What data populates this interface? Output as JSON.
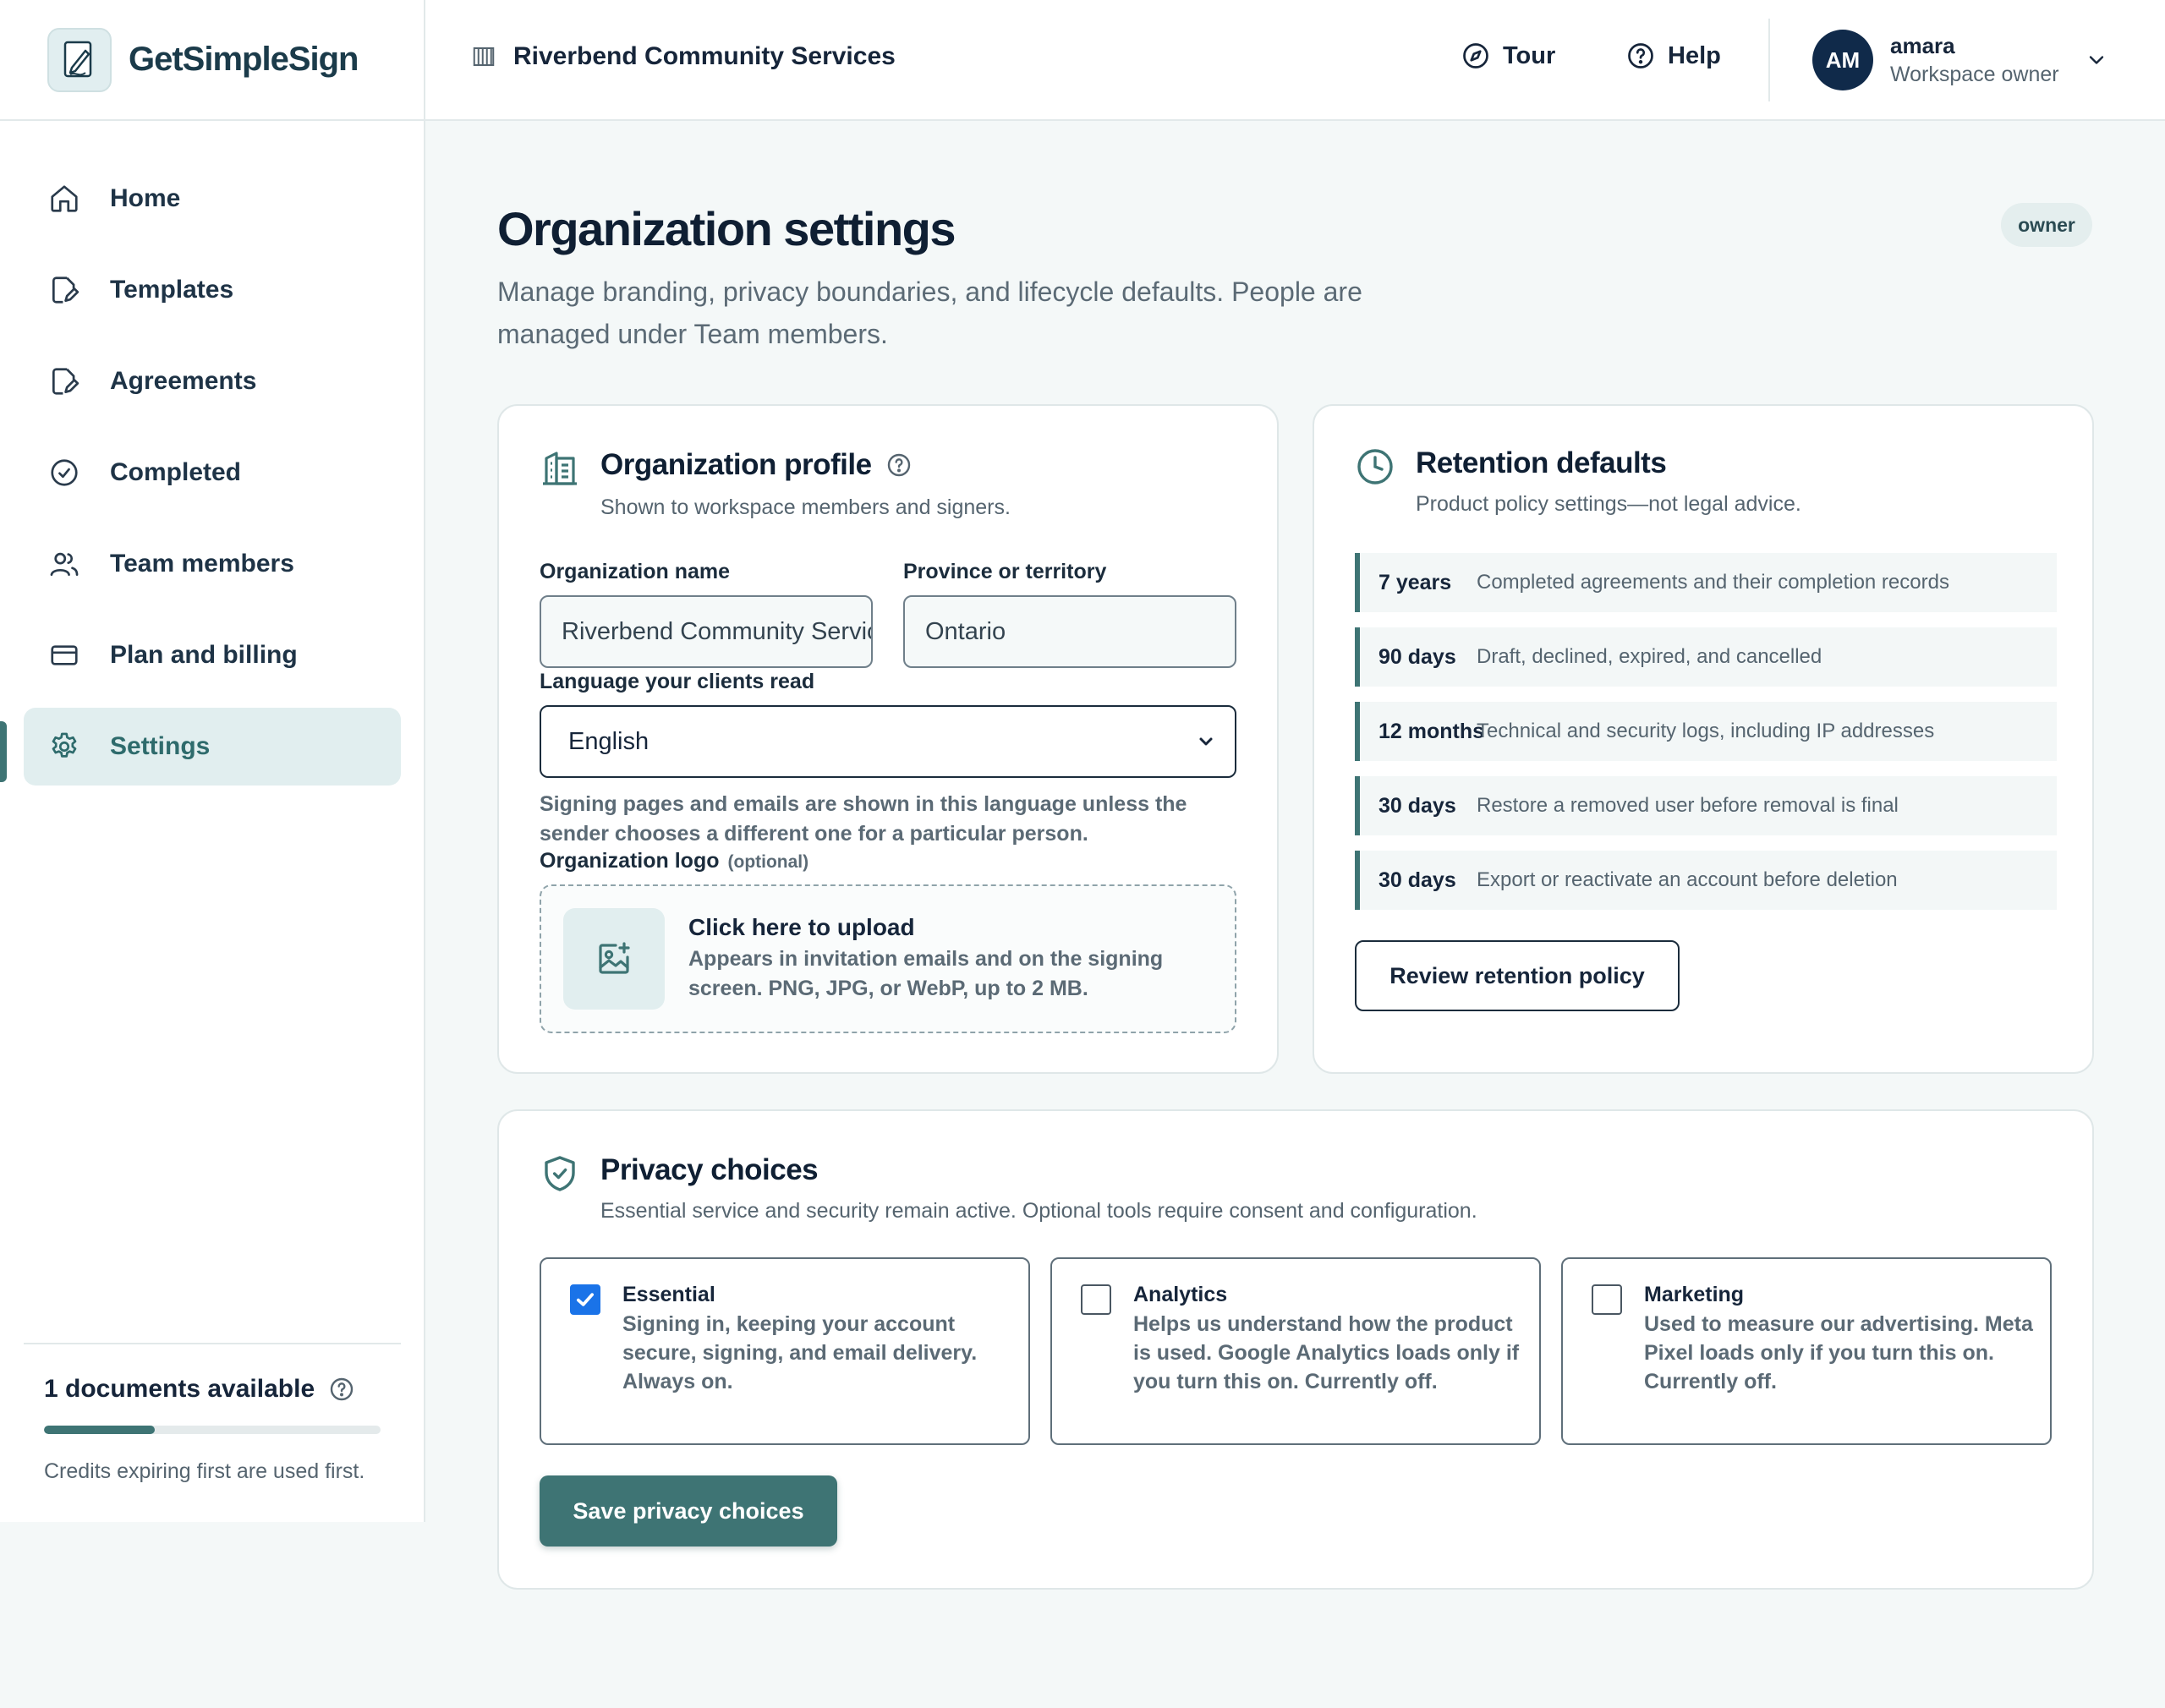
{
  "app": {
    "name": "GetSimpleSign"
  },
  "header": {
    "organization": "Riverbend Community Services",
    "tour_label": "Tour",
    "help_label": "Help",
    "user": {
      "initials": "AM",
      "name": "amara",
      "role": "Workspace owner"
    }
  },
  "sidebar": {
    "items": [
      {
        "label": "Home",
        "icon": "home-icon"
      },
      {
        "label": "Templates",
        "icon": "document-edit-icon"
      },
      {
        "label": "Agreements",
        "icon": "document-edit-icon"
      },
      {
        "label": "Completed",
        "icon": "check-circle-icon"
      },
      {
        "label": "Team members",
        "icon": "users-icon"
      },
      {
        "label": "Plan and billing",
        "icon": "credit-card-icon"
      },
      {
        "label": "Settings",
        "icon": "gear-icon",
        "active": true
      }
    ],
    "credits": {
      "title": "1 documents available",
      "note": "Credits expiring first are used first.",
      "usage_fraction": 0.33
    }
  },
  "page": {
    "title": "Organization settings",
    "role_badge": "owner",
    "subtitle": "Manage branding, privacy boundaries, and lifecycle defaults. People are managed under Team members."
  },
  "profile": {
    "title": "Organization profile",
    "subtitle": "Shown to workspace members and signers.",
    "org_name_label": "Organization name",
    "org_name_value": "Riverbend Community Services",
    "province_label": "Province or territory",
    "province_value": "Ontario",
    "language_label": "Language your clients read",
    "language_value": "English",
    "language_help": "Signing pages and emails are shown in this language unless the sender chooses a different one for a particular person.",
    "logo_label": "Organization logo",
    "logo_optional": "(optional)",
    "upload_title": "Click here to upload",
    "upload_desc": "Appears in invitation emails and on the signing screen. PNG, JPG, or WebP, up to 2 MB."
  },
  "retention": {
    "title": "Retention defaults",
    "subtitle": "Product policy settings—not legal advice.",
    "rows": [
      {
        "duration": "7 years",
        "description": "Completed agreements and their completion records"
      },
      {
        "duration": "90 days",
        "description": "Draft, declined, expired, and cancelled"
      },
      {
        "duration": "12 months",
        "description": "Technical and security logs, including IP addresses"
      },
      {
        "duration": "30 days",
        "description": "Restore a removed user before removal is final"
      },
      {
        "duration": "30 days",
        "description": "Export or reactivate an account before deletion"
      }
    ],
    "review_button": "Review retention policy"
  },
  "privacy": {
    "title": "Privacy choices",
    "subtitle": "Essential service and security remain active. Optional tools require consent and configuration.",
    "choices": [
      {
        "name": "Essential",
        "description": "Signing in, keeping your account secure, signing, and email delivery. Always on.",
        "checked": true
      },
      {
        "name": "Analytics",
        "description": "Helps us understand how the product is used. Google Analytics loads only if you turn this on. Currently off.",
        "checked": false
      },
      {
        "name": "Marketing",
        "description": "Used to measure our advertising. Meta Pixel loads only if you turn this on. Currently off.",
        "checked": false
      }
    ],
    "save_button": "Save privacy choices"
  },
  "colors": {
    "accent": "#3e7474",
    "accent_light": "#e1eeef",
    "avatar": "#102a4a",
    "checkbox": "#1a73e8"
  }
}
